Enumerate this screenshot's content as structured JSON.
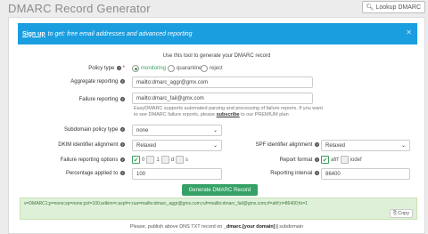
{
  "app": {
    "title": "DMARC Record Generator",
    "lookup_label": "Lookup DMARC"
  },
  "banner": {
    "link": "Sign up",
    "text": "to get: free email addresses and advanced reporting"
  },
  "intro": "Use this tool to generate your DMARC record",
  "policy_type": {
    "label": "Policy type",
    "options": [
      "monitoring",
      "quarantine",
      "reject"
    ],
    "selected": "monitoring"
  },
  "aggregate": {
    "label": "Aggregate reporting",
    "value": "mailto:dmarc_aggr@gmx.com"
  },
  "failure": {
    "label": "Failure reporting",
    "value": "mailto:dmarc_fail@gmx.com"
  },
  "help": {
    "line": "EasyDMARC supports automated parsing and processing of failure reports. If you want to see DMARC failure reports, please",
    "link": "subscribe",
    "tail": "to our PREMIUM plan"
  },
  "subdomain": {
    "label": "Subdomain policy type",
    "value": "none"
  },
  "dkim": {
    "label": "DKIM identifier alignment",
    "value": "Relaxed"
  },
  "spf": {
    "label": "SPF identifier alignment",
    "value": "Relaxed"
  },
  "failure_opts": {
    "label": "Failure reporting options",
    "items": [
      {
        "label": "0",
        "checked": true
      },
      {
        "label": "1",
        "checked": false
      },
      {
        "label": "d",
        "checked": false
      },
      {
        "label": "s",
        "checked": false
      }
    ]
  },
  "report_format": {
    "label": "Report format",
    "items": [
      {
        "label": "afrf",
        "checked": true
      },
      {
        "label": "iodef",
        "checked": false
      }
    ]
  },
  "percentage": {
    "label": "Percentage applied to",
    "value": "100"
  },
  "interval": {
    "label": "Reporting interval",
    "value": "86400"
  },
  "generate_label": "Generate DMARC Record",
  "result": {
    "text": "v=DMARC1;p=none;sp=none;pct=100;adkim=r;aspf=r;rua=mailto:dmarc_aggr@gmx.com;ruf=mailto:dmarc_fail@gmx.com;rf=afrf;ri=86400;fo=1",
    "copy_label": "Copy"
  },
  "note": {
    "pre": "Please, publish above DNS TXT record on",
    "host": "_dmarc.",
    "mid": "[your domain]",
    "sep": "|",
    "tail": "subdomain"
  },
  "colors": {
    "accent": "#1a9ee0",
    "success": "#35a166",
    "result_bg": "#dff0d8"
  }
}
